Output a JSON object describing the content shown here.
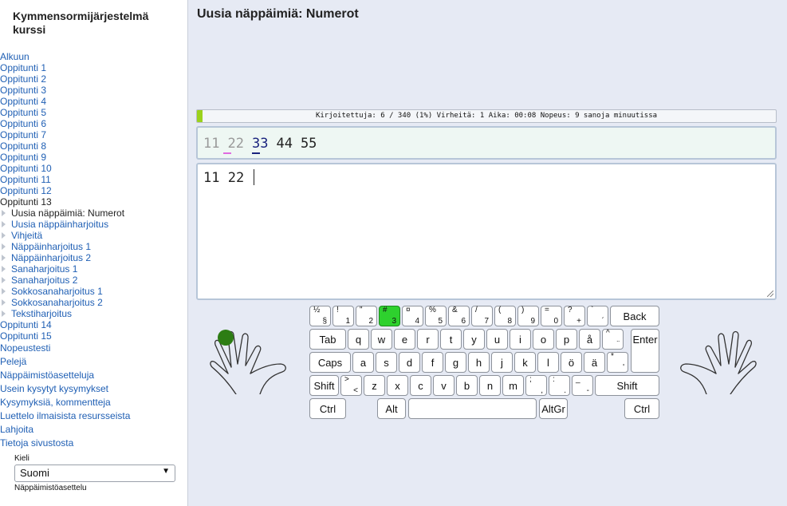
{
  "sidebar": {
    "title": "Kymmensormijärjestelmä kurssi",
    "home": "Alkuun",
    "lessons": [
      "Oppitunti 1",
      "Oppitunti 2",
      "Oppitunti 3",
      "Oppitunti 4",
      "Oppitunti 5",
      "Oppitunti 6",
      "Oppitunti 7",
      "Oppitunti 8",
      "Oppitunti 9",
      "Oppitunti 10",
      "Oppitunti 11",
      "Oppitunti 12"
    ],
    "current_lesson": "Oppitunti 13",
    "sub_items": [
      "Uusia näppäimiä: Numerot",
      "Uusia näppäinharjoitus",
      "Vihjeitä",
      "Näppäinharjoitus 1",
      "Näppäinharjoitus 2",
      "Sanaharjoitus 1",
      "Sanaharjoitus 2",
      "Sokkosanaharjoitus 1",
      "Sokkosanaharjoitus 2",
      "Tekstiharjoitus"
    ],
    "lessons_after": [
      "Oppitunti 14",
      "Oppitunti 15"
    ],
    "extra_links": [
      "Nopeustesti",
      "Pelejä",
      "Näppäimistöasetteluja",
      "Usein kysytyt kysymykset",
      "Kysymyksiä, kommentteja",
      "Luettelo ilmaisista resursseista",
      "Lahjoita",
      "Tietoja sivustosta"
    ],
    "language_label": "Kieli",
    "language_value": "Suomi",
    "keyboard_setting_label": "Näppäimistöasettelu"
  },
  "main": {
    "title": "Uusia näppäimiä: Numerot",
    "stats": "Kirjoitettuja: 6 / 340 (1%) Virheitä: 1 Aika: 00:08 Nopeus: 9 sanoja minuutissa",
    "progress_fraction": 0.01,
    "progress_color": "#9bd21c",
    "target_tokens": [
      "11",
      "22",
      "33",
      "44",
      "55"
    ],
    "typed_text": "11 22 "
  },
  "keyboard": {
    "highlight_color": "#2ed12e",
    "row1": [
      {
        "up": "½",
        "lo": "§"
      },
      {
        "up": "!",
        "lo": "1"
      },
      {
        "up": "\"",
        "lo": "2"
      },
      {
        "up": "#",
        "lo": "3"
      },
      {
        "up": "¤",
        "lo": "4"
      },
      {
        "up": "%",
        "lo": "5"
      },
      {
        "up": "&",
        "lo": "6"
      },
      {
        "up": "/",
        "lo": "7"
      },
      {
        "up": "(",
        "lo": "8"
      },
      {
        "up": ")",
        "lo": "9"
      },
      {
        "up": "=",
        "lo": "0"
      },
      {
        "up": "?",
        "lo": "+"
      },
      {
        "up": "`",
        "lo": "´"
      }
    ],
    "back": "Back",
    "tab": "Tab",
    "row2": [
      "q",
      "w",
      "e",
      "r",
      "t",
      "y",
      "u",
      "i",
      "o",
      "p",
      "å"
    ],
    "row2_extra": {
      "up": "^",
      "lo": "¨"
    },
    "enter": "Enter",
    "caps": "Caps",
    "row3": [
      "a",
      "s",
      "d",
      "f",
      "g",
      "h",
      "j",
      "k",
      "l",
      "ö",
      "ä"
    ],
    "row3_extra": {
      "up": "*",
      "lo": "'"
    },
    "shift": "Shift",
    "row4_first": {
      "up": ">",
      "lo": "<"
    },
    "row4": [
      "z",
      "x",
      "c",
      "v",
      "b",
      "n",
      "m"
    ],
    "row4_punct": [
      {
        "up": ";",
        "lo": ","
      },
      {
        "up": ":",
        "lo": "."
      },
      {
        "up": "_",
        "lo": "-"
      }
    ],
    "ctrl": "Ctrl",
    "alt": "Alt",
    "altgr": "AltGr"
  }
}
